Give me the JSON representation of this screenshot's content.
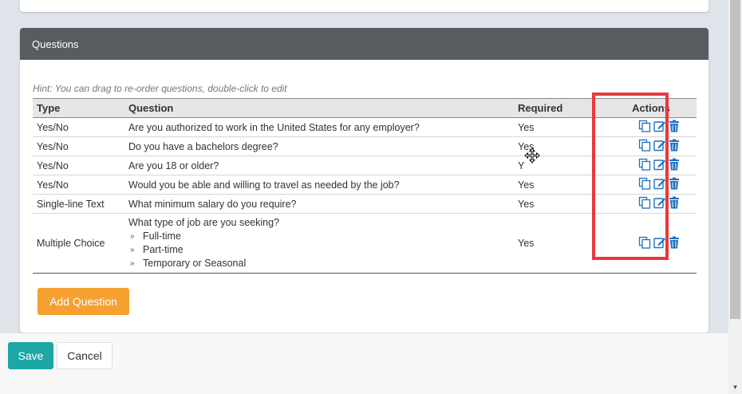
{
  "panel": {
    "title": "Questions",
    "hint": "Hint: You can drag to re-order questions, double-click to edit",
    "add_button": "Add Question"
  },
  "table": {
    "headers": {
      "type": "Type",
      "question": "Question",
      "required": "Required",
      "actions": "Actions"
    },
    "rows": [
      {
        "type": "Yes/No",
        "question": "Are you authorized to work in the United States for any employer?",
        "required": "Yes"
      },
      {
        "type": "Yes/No",
        "question": "Do you have a bachelors degree?",
        "required": "Yes"
      },
      {
        "type": "Yes/No",
        "question": "Are you 18 or older?",
        "required": "Y"
      },
      {
        "type": "Yes/No",
        "question": "Would you be able and willing to travel as needed by the job?",
        "required": "Yes"
      },
      {
        "type": "Single-line Text",
        "question": "What minimum salary do you require?",
        "required": "Yes"
      }
    ],
    "mc_row": {
      "type": "Multiple Choice",
      "question": "What type of job are you seeking?",
      "options": [
        "Full-time",
        "Part-time",
        "Temporary or Seasonal"
      ],
      "required": "Yes"
    },
    "action_icons": [
      "copy-icon",
      "edit-icon",
      "trash-icon"
    ],
    "icon_color": "#1f6fc1"
  },
  "footer": {
    "save": "Save",
    "cancel": "Cancel"
  },
  "colors": {
    "panel_header": "#585c61",
    "add_button": "#f5a030",
    "save_button": "#1ca6a6",
    "highlight": "#e9383f"
  }
}
